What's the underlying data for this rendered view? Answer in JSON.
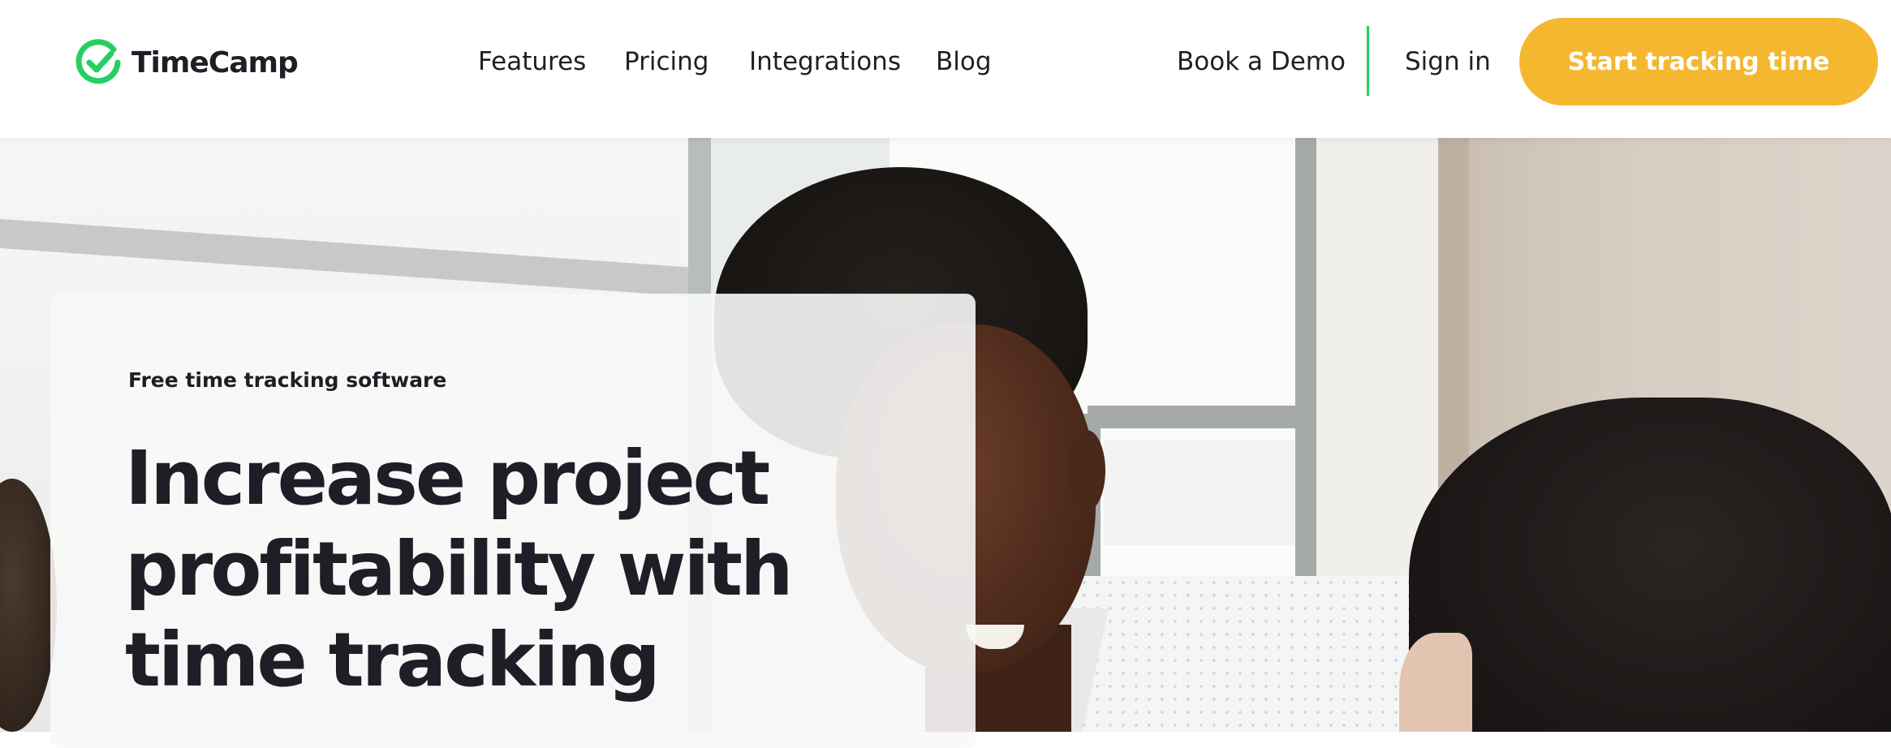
{
  "brand": {
    "name": "TimeCamp",
    "accent_color": "#25cf60",
    "icon": "check-circle-icon"
  },
  "nav": {
    "items": [
      {
        "label": "Features"
      },
      {
        "label": "Pricing"
      },
      {
        "label": "Integrations"
      },
      {
        "label": "Blog"
      }
    ]
  },
  "header_actions": {
    "book_demo": "Book a Demo",
    "sign_in": "Sign in",
    "cta": "Start tracking time",
    "cta_color": "#f5b730"
  },
  "hero": {
    "eyebrow": "Free time tracking software",
    "headline": "Increase project profitability with time tracking"
  }
}
